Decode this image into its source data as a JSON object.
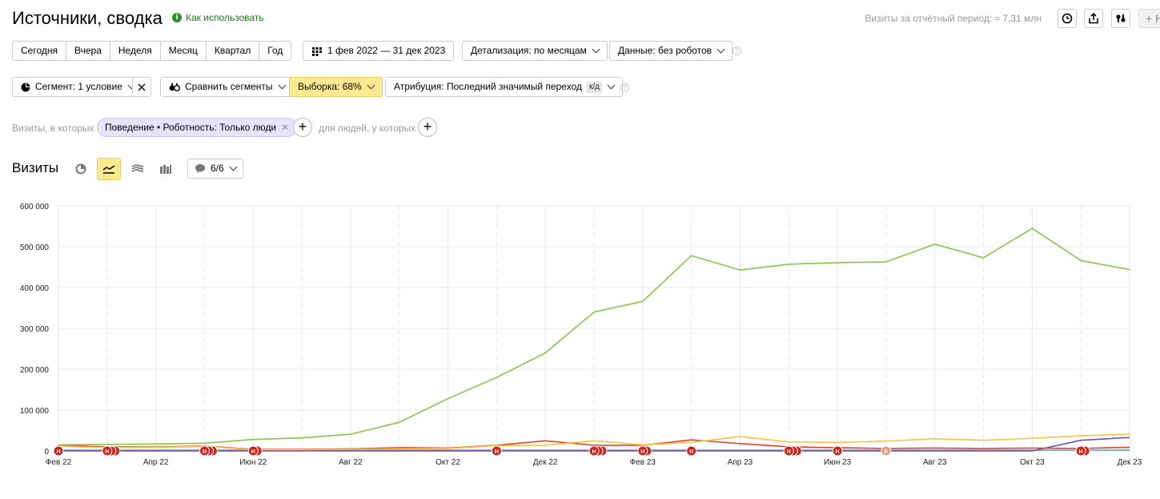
{
  "header": {
    "title": "Источники, сводка",
    "how_to_use": "Как использовать",
    "visits_total": "Визиты за отчётный период: ≈ 7,31 млн",
    "add_label": "+ Н"
  },
  "period_buttons": [
    "Сегодня",
    "Вчера",
    "Неделя",
    "Месяц",
    "Квартал",
    "Год"
  ],
  "date_range": "1 фев 2022 — 31 дек 2023",
  "detail": "Детализация: по месяцам",
  "data_mode": "Данные: без роботов",
  "segment": "Сегмент: 1 условие",
  "compare": "Сравнить сегменты",
  "sample": "Выборка: 68%",
  "attribution": "Атрибуция: Последний значимый переход",
  "attribution_badge": "к/д",
  "filters": {
    "label": "Визиты, в которых",
    "chip": "Поведение • Роботность: Только люди",
    "people_label": "для людей, у которых"
  },
  "chart_section": {
    "title": "Визиты",
    "notes": "6/6"
  },
  "chart_data": {
    "type": "line",
    "x": [
      "Фев 22",
      "Мар 22",
      "Апр 22",
      "Май 22",
      "Июн 22",
      "Июл 22",
      "Авг 22",
      "Сен 22",
      "Окт 22",
      "Ноя 22",
      "Дек 22",
      "Янв 23",
      "Фев 23",
      "Мар 23",
      "Апр 23",
      "Май 23",
      "Июн 23",
      "Июл 23",
      "Авг 23",
      "Сен 23",
      "Окт 23",
      "Ноя 23",
      "Дек 23"
    ],
    "x_tick_labels": [
      "Фев 22",
      "Апр 22",
      "Июн 22",
      "Авг 22",
      "Окт 22",
      "Дек 22",
      "Фев 23",
      "Апр 23",
      "Июн 23",
      "Авг 23",
      "Окт 23",
      "Дек 23"
    ],
    "y_tick_labels": [
      "0",
      "100 000",
      "200 000",
      "300 000",
      "400 000",
      "500 000",
      "600 000"
    ],
    "ylim": [
      0,
      600000
    ],
    "grid": true,
    "series": [
      {
        "color": "#8bc34a",
        "values": [
          15000,
          16000,
          17000,
          19000,
          28000,
          32000,
          41000,
          70000,
          128000,
          180000,
          240000,
          340000,
          366000,
          478000,
          443000,
          457000,
          461000,
          463000,
          506000,
          473000,
          545000,
          466000,
          444000
        ]
      },
      {
        "color": "#f5c443",
        "values": [
          12000,
          8000,
          9000,
          11000,
          3000,
          3000,
          4000,
          5000,
          6000,
          13000,
          14000,
          25000,
          15000,
          21000,
          35000,
          22000,
          21000,
          24000,
          30000,
          26000,
          31000,
          37000,
          41000
        ]
      },
      {
        "color": "#e0442c",
        "values": [
          14000,
          10000,
          10000,
          12000,
          4000,
          4000,
          5000,
          8000,
          7000,
          14000,
          25000,
          14000,
          14000,
          27000,
          18000,
          10000,
          8000,
          6000,
          7000,
          6000,
          7000,
          6000,
          9000
        ]
      },
      {
        "color": "#7e4a9f",
        "values": [
          0,
          0,
          0,
          0,
          0,
          0,
          0,
          0,
          0,
          0,
          0,
          0,
          0,
          0,
          0,
          0,
          0,
          0,
          0,
          0,
          0,
          26000,
          33000
        ]
      },
      {
        "color": "#5b9bd5",
        "values": [
          2000,
          2000,
          2000,
          2000,
          2000,
          2000,
          2000,
          2000,
          2000,
          2000,
          2000,
          2000,
          2000,
          2000,
          2000,
          2000,
          2000,
          2000,
          2000,
          2000,
          2000,
          2000,
          2000
        ]
      }
    ],
    "annotations": [
      {
        "x": "Фев 22",
        "label": "Н",
        "count": 1
      },
      {
        "x": "Мар 22",
        "label": "Н",
        "count": 3
      },
      {
        "x": "Май 22",
        "label": "Н",
        "count": 3
      },
      {
        "x": "Июн 22",
        "label": "Н",
        "count": 2
      },
      {
        "x": "Ноя 22",
        "label": "Н",
        "count": 1
      },
      {
        "x": "Янв 23",
        "label": "Н",
        "count": 3
      },
      {
        "x": "Фев 23",
        "label": "Н",
        "count": 2
      },
      {
        "x": "Мар 23",
        "label": "Н",
        "count": 1
      },
      {
        "x": "Май 23",
        "label": "Н",
        "count": 3
      },
      {
        "x": "Июн 23",
        "label": "Н",
        "count": 1
      },
      {
        "x": "Июл 23",
        "label": "Е",
        "count": 1
      },
      {
        "x": "Ноя 23",
        "label": "Н",
        "count": 2
      }
    ]
  }
}
